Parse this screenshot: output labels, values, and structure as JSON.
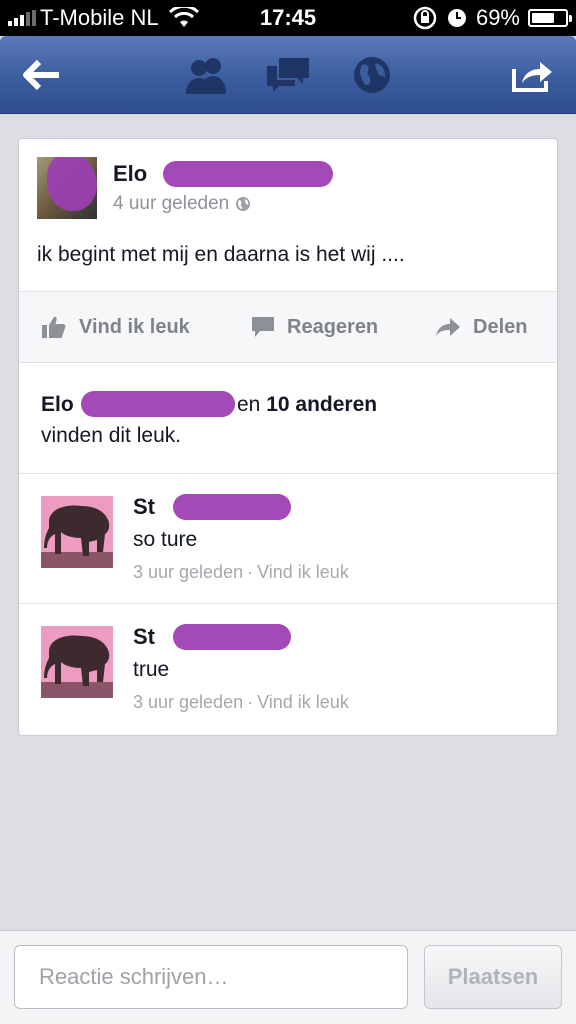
{
  "status_bar": {
    "carrier": "T-Mobile NL",
    "time": "17:45",
    "battery": "69%",
    "battery_level": 0.69
  },
  "nav": {
    "icons": [
      "back-arrow-icon",
      "friends-icon",
      "messages-icon",
      "notifications-globe-icon",
      "share-icon"
    ]
  },
  "post": {
    "author_prefix": "Elo",
    "time": "4 uur geleden",
    "text": "ik begint met mij en daarna is het wij ....",
    "actions": {
      "like": "Vind ik leuk",
      "comment": "Reageren",
      "share": "Delen"
    },
    "likes": {
      "name_prefix": "Elo",
      "connector": "en",
      "others": "10 anderen",
      "suffix": "vinden dit leuk."
    }
  },
  "comments": [
    {
      "author_prefix": "St",
      "text": "so ture",
      "time": "3 uur geleden",
      "separator": "·",
      "like": "Vind ik leuk"
    },
    {
      "author_prefix": "St",
      "text": "true",
      "time": "3 uur geleden",
      "separator": "·",
      "like": "Vind ik leuk"
    }
  ],
  "composer": {
    "placeholder": "Reactie schrijven…",
    "post_label": "Plaatsen"
  },
  "colors": {
    "nav_blue": "#3b5c9e",
    "redaction": "#a349b8"
  }
}
